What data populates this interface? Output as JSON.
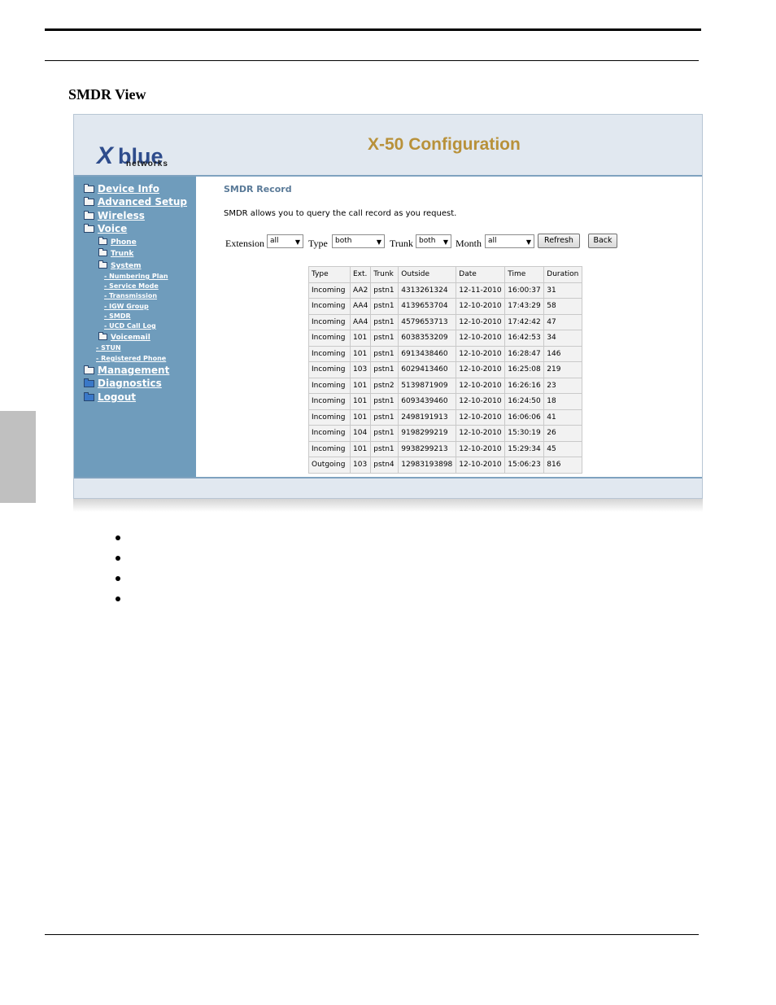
{
  "document": {
    "section_title": "SMDR View"
  },
  "app": {
    "title": "X-50 Configuration",
    "logo": {
      "brand_mark": "X",
      "brand_word": "blue",
      "brand_sub": "networks"
    }
  },
  "sidebar": {
    "items": [
      {
        "label": "Device Info"
      },
      {
        "label": "Advanced Setup"
      },
      {
        "label": "Wireless"
      },
      {
        "label": "Voice"
      },
      {
        "label": "Phone"
      },
      {
        "label": "Trunk"
      },
      {
        "label": "System"
      },
      {
        "label": "- Numbering Plan"
      },
      {
        "label": "- Service Mode"
      },
      {
        "label": "- Transmission"
      },
      {
        "label": "- IGW Group"
      },
      {
        "label": "- SMDR"
      },
      {
        "label": "- UCD Call Log"
      },
      {
        "label": "Voicemail"
      },
      {
        "label": "- STUN"
      },
      {
        "label": "- Registered Phone"
      },
      {
        "label": "Management"
      },
      {
        "label": "Diagnostics"
      },
      {
        "label": "Logout"
      }
    ]
  },
  "main": {
    "title": "SMDR Record",
    "description": "SMDR allows you to query the call record as you request.",
    "filters": {
      "extension": {
        "label": "Extension",
        "value": "all"
      },
      "type": {
        "label": "Type",
        "value": "both"
      },
      "trunk": {
        "label": "Trunk",
        "value": "both"
      },
      "month": {
        "label": "Month",
        "value": "all"
      }
    },
    "buttons": {
      "refresh": "Refresh",
      "back": "Back"
    },
    "table": {
      "headers": [
        "Type",
        "Ext.",
        "Trunk",
        "Outside",
        "Date",
        "Time",
        "Duration"
      ],
      "rows": [
        [
          "Incoming",
          "AA2",
          "pstn1",
          "4313261324",
          "12-11-2010",
          "16:00:37",
          "31"
        ],
        [
          "Incoming",
          "AA4",
          "pstn1",
          "4139653704",
          "12-10-2010",
          "17:43:29",
          "58"
        ],
        [
          "Incoming",
          "AA4",
          "pstn1",
          "4579653713",
          "12-10-2010",
          "17:42:42",
          "47"
        ],
        [
          "Incoming",
          "101",
          "pstn1",
          "6038353209",
          "12-10-2010",
          "16:42:53",
          "34"
        ],
        [
          "Incoming",
          "101",
          "pstn1",
          "6913438460",
          "12-10-2010",
          "16:28:47",
          "146"
        ],
        [
          "Incoming",
          "103",
          "pstn1",
          "6029413460",
          "12-10-2010",
          "16:25:08",
          "219"
        ],
        [
          "Incoming",
          "101",
          "pstn2",
          "5139871909",
          "12-10-2010",
          "16:26:16",
          "23"
        ],
        [
          "Incoming",
          "101",
          "pstn1",
          "6093439460",
          "12-10-2010",
          "16:24:50",
          "18"
        ],
        [
          "Incoming",
          "101",
          "pstn1",
          "2498191913",
          "12-10-2010",
          "16:06:06",
          "41"
        ],
        [
          "Incoming",
          "104",
          "pstn1",
          "9198299219",
          "12-10-2010",
          "15:30:19",
          "26"
        ],
        [
          "Incoming",
          "101",
          "pstn1",
          "9938299213",
          "12-10-2010",
          "15:29:34",
          "45"
        ],
        [
          "Outgoing",
          "103",
          "pstn4",
          "12983193898",
          "12-10-2010",
          "15:06:23",
          "816"
        ]
      ]
    }
  },
  "colors": {
    "sidebar_bg": "#6f9cbc",
    "header_bg": "#e1e8f0",
    "title_gold": "#b8913a",
    "record_title": "#5a7a98"
  }
}
